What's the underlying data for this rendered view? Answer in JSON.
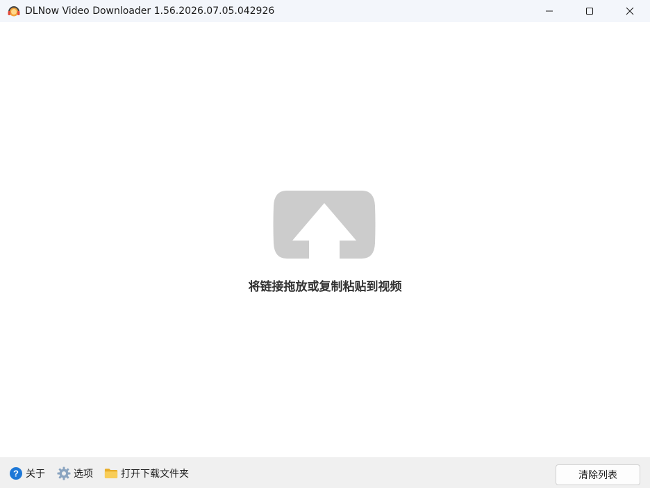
{
  "window": {
    "title": "DLNow Video Downloader 1.56.2026.07.05.042926",
    "icon": "headphones-app-icon",
    "controls": [
      "minimize-icon",
      "maximize-icon",
      "close-icon"
    ]
  },
  "main": {
    "drop_icon": "upload-arrow-icon",
    "drop_hint": "将链接拖放或复制粘贴到视频"
  },
  "bottombar": {
    "about_label": "关于",
    "options_label": "选项",
    "open_folder_label": "打开下载文件夹",
    "clear_list_label": "清除列表"
  },
  "colors": {
    "titlebar_bg": "#f3f6fb",
    "bottombar_bg": "#f0f0f0",
    "upload_icon": "#cccccc",
    "help_icon": "#1e78d7",
    "folder_icon": "#f5c242"
  }
}
